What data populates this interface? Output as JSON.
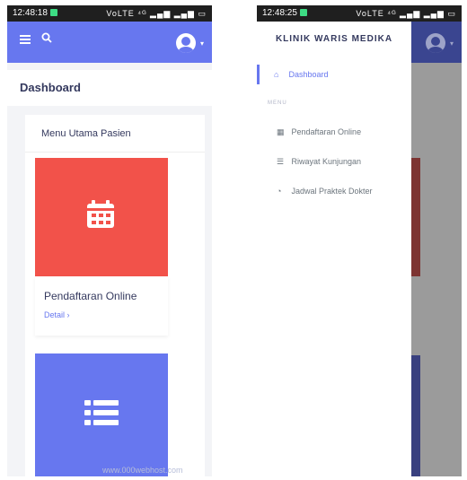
{
  "screen_left": {
    "status_time": "12:48:18",
    "status_icons": "VoLTE ⁴ᴳ ▂▄▆ ▂▄▆ ▭",
    "section_title": "Dashboard",
    "card_title": "Menu Utama Pasien",
    "tile_title": "Pendaftaran Online",
    "tile_link": "Detail ›",
    "watermark": "www.000webhost.com"
  },
  "screen_right": {
    "status_time": "12:48:25",
    "status_icons": "VoLTE ⁴ᴳ ▂▄▆ ▂▄▆ ▭",
    "brand": "KLINIK WARIS MEDIKA",
    "nav_dashboard": "Dashboard",
    "menu_header": "MENU",
    "nav_pendaftaran": "Pendaftaran Online",
    "nav_riwayat": "Riwayat Kunjungan",
    "nav_jadwal": "Jadwal Praktek Dokter"
  },
  "icons": {
    "hamburger": "hamburger-icon",
    "search": "search-icon",
    "avatar": "user-avatar-icon",
    "calendar": "calendar-icon",
    "list": "list-icon",
    "home": "home-icon",
    "clock": "clock-icon"
  },
  "colors": {
    "primary": "#6777ef",
    "danger": "#f2524a"
  }
}
